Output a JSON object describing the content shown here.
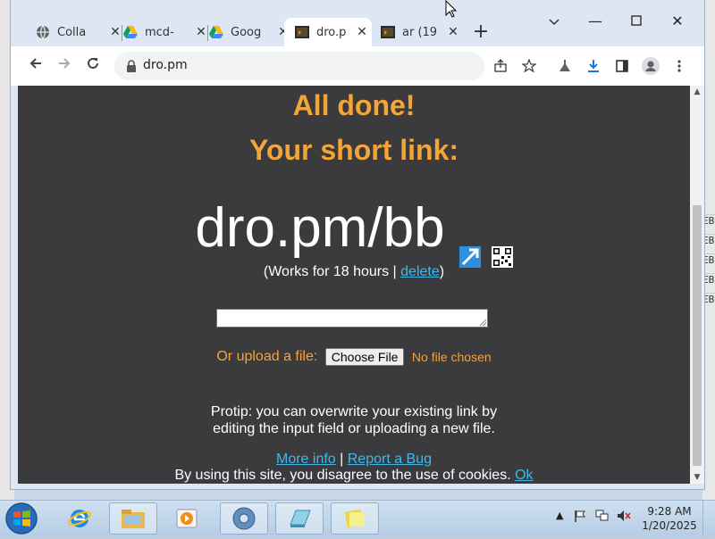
{
  "browser": {
    "tabs": [
      {
        "label": "Colla",
        "icon": "globe-icon",
        "active": false
      },
      {
        "label": "mcd-",
        "icon": "google-drive-icon",
        "active": false
      },
      {
        "label": "Goog",
        "icon": "google-drive-icon",
        "active": false
      },
      {
        "label": "dro.p",
        "icon": "terminal-favicon-icon",
        "active": true
      },
      {
        "label": "ar (19",
        "icon": "terminal-favicon-icon",
        "active": false
      }
    ],
    "url": "dro.pm"
  },
  "page": {
    "heading1": "All done!",
    "heading2": "Your short link:",
    "short_link": "dro.pm/bb",
    "works_prefix": "(Works for 18 hours | ",
    "delete_label": "delete",
    "works_suffix": ")",
    "textarea_value": "",
    "upload_label": "Or upload a file:",
    "choose_file_label": "Choose File",
    "no_file_label": "No file chosen",
    "protip_line1": "Protip: you can overwrite your existing link by",
    "protip_line2": "editing the input field or uploading a new file.",
    "more_info_label": "More info",
    "separator": " | ",
    "report_bug_label": "Report a Bug",
    "cookies_text": "By using this site, you disagree to the use of cookies. ",
    "ok_label": "Ok"
  },
  "taskbar": {
    "time": "9:28 AM",
    "date": "1/20/2025"
  },
  "desktop": {
    "right_strip_labels": [
      "EB",
      "EB",
      "EB",
      "EB",
      "EB"
    ]
  },
  "colors": {
    "page_bg": "#3b3a3d",
    "accent_orange": "#f3a537",
    "link_blue": "#41b8e8"
  }
}
